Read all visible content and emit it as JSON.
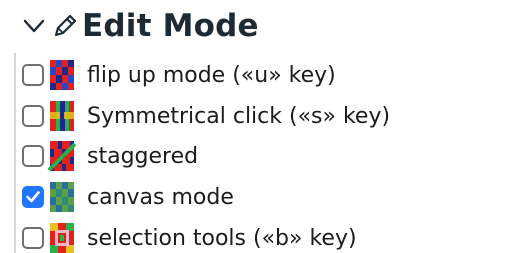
{
  "section": {
    "title": "Edit Mode",
    "expanded": true,
    "chevron_icon": "chevron-down-icon",
    "title_icon": "pencil-icon"
  },
  "options": [
    {
      "label": "flip up mode («u» key)",
      "checked": false,
      "icon": "flip-up-mode-icon"
    },
    {
      "label": "Symmetrical click («s» key)",
      "checked": false,
      "icon": "symmetrical-click-icon"
    },
    {
      "label": "staggered",
      "checked": false,
      "icon": "staggered-icon"
    },
    {
      "label": "canvas mode",
      "checked": true,
      "icon": "canvas-mode-icon"
    },
    {
      "label": "selection tools («b» key)",
      "checked": false,
      "icon": "selection-tools-icon"
    }
  ],
  "colors": {
    "checkbox_checked": "#1f77ff",
    "title_text": "#1d2a33"
  }
}
